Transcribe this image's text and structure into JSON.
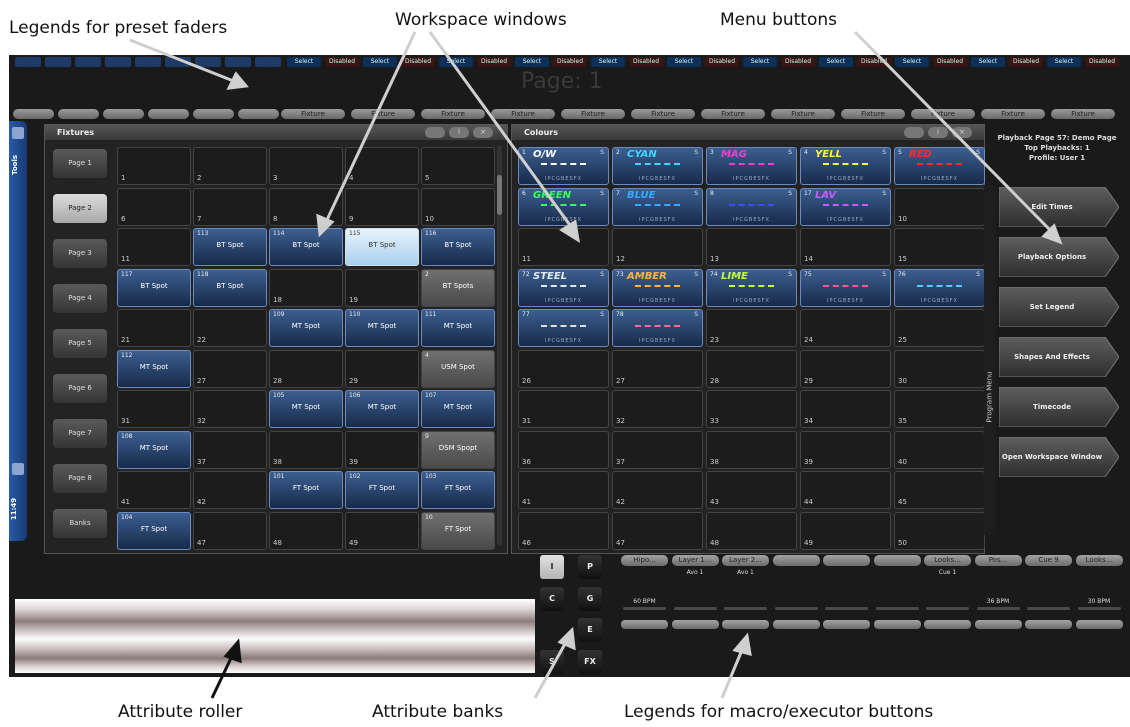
{
  "annotations": {
    "preset_faders": "Legends for preset faders",
    "workspace_windows": "Workspace windows",
    "menu_buttons": "Menu buttons",
    "attribute_roller": "Attribute roller",
    "attribute_banks": "Attribute banks",
    "macro_executor": "Legends for macro/executor buttons"
  },
  "top_strip": [
    {
      "label": "Select",
      "color": "#0d2f5a"
    },
    {
      "label": "Disabled",
      "color": "#3a1414"
    },
    {
      "label": "Select",
      "color": "#0d2f5a"
    },
    {
      "label": "Disabled",
      "color": "#3a1414"
    },
    {
      "label": "Select",
      "color": "#0d2f5a"
    },
    {
      "label": "Disabled",
      "color": "#3a1414"
    },
    {
      "label": "Select",
      "color": "#0d2f5a"
    },
    {
      "label": "Disabled",
      "color": "#3a1414"
    },
    {
      "label": "Select",
      "color": "#0d2f5a"
    },
    {
      "label": "Disabled",
      "color": "#3a1414"
    },
    {
      "label": "Select",
      "color": "#0d2f5a"
    },
    {
      "label": "Disabled",
      "color": "#3a1414"
    },
    {
      "label": "Select",
      "color": "#0d2f5a"
    },
    {
      "label": "Disabled",
      "color": "#3a1414"
    },
    {
      "label": "Select",
      "color": "#0d2f5a"
    },
    {
      "label": "Disabled",
      "color": "#3a1414"
    },
    {
      "label": "Select",
      "color": "#0d2f5a"
    },
    {
      "label": "Disabled",
      "color": "#3a1414"
    },
    {
      "label": "Select",
      "color": "#0d2f5a"
    },
    {
      "label": "Disabled",
      "color": "#3a1414"
    },
    {
      "label": "Select",
      "color": "#0d2f5a"
    },
    {
      "label": "Disabled",
      "color": "#3a1414"
    }
  ],
  "page_title": "Page: 1",
  "fixture_row": [
    "Fixture",
    "Fixture",
    "Fixture",
    "Fixture",
    "Fixture",
    "Fixture",
    "Fixture",
    "Fixture",
    "Fixture",
    "Fixture",
    "Fixture",
    "Fixture"
  ],
  "side_tab": {
    "tools": "Tools",
    "clock": "11:49"
  },
  "fixtures_window": {
    "title": "Fixtures",
    "pages": [
      "Page 1",
      "Page 2",
      "Page 3",
      "Page 4",
      "Page 5",
      "Page 6",
      "Page 7",
      "Page 8",
      "Banks"
    ],
    "selected_page": 1,
    "rows": [
      [
        {
          "n": "1"
        },
        {
          "n": "2"
        },
        {
          "n": "3"
        },
        {
          "n": "4"
        },
        {
          "n": "5"
        }
      ],
      [
        {
          "n": "6"
        },
        {
          "n": "7"
        },
        {
          "n": "8"
        },
        {
          "n": "9"
        },
        {
          "n": "10"
        }
      ],
      [
        {
          "n": "11"
        },
        {
          "n": "113",
          "label": "BT Spot",
          "style": "blue"
        },
        {
          "n": "114",
          "label": "BT Spot",
          "style": "blue"
        },
        {
          "n": "115",
          "label": "BT Spot",
          "style": "light"
        },
        {
          "n": "116",
          "label": "BT Spot",
          "style": "blue"
        }
      ],
      [
        {
          "n": "117",
          "label": "BT Spot",
          "style": "blue"
        },
        {
          "n": "118",
          "label": "BT Spot",
          "style": "blue"
        },
        {
          "n": "18"
        },
        {
          "n": "19"
        },
        {
          "n": "2",
          "label": "BT Spots",
          "style": "grey"
        }
      ],
      [
        {
          "n": "21"
        },
        {
          "n": "22"
        },
        {
          "n": "109",
          "label": "MT Spot",
          "style": "blue"
        },
        {
          "n": "110",
          "label": "MT Spot",
          "style": "blue"
        },
        {
          "n": "111",
          "label": "MT Spot",
          "style": "blue"
        }
      ],
      [
        {
          "n": "112",
          "label": "MT Spot",
          "style": "blue"
        },
        {
          "n": "27"
        },
        {
          "n": "28"
        },
        {
          "n": "29"
        },
        {
          "n": "4",
          "label": "USM Spot",
          "style": "grey"
        }
      ],
      [
        {
          "n": "31"
        },
        {
          "n": "32"
        },
        {
          "n": "105",
          "label": "MT Spot",
          "style": "blue"
        },
        {
          "n": "106",
          "label": "MT Spot",
          "style": "blue"
        },
        {
          "n": "107",
          "label": "MT Spot",
          "style": "blue"
        }
      ],
      [
        {
          "n": "108",
          "label": "MT Spot",
          "style": "blue"
        },
        {
          "n": "37"
        },
        {
          "n": "38"
        },
        {
          "n": "39"
        },
        {
          "n": "9",
          "label": "DSM Spopt",
          "style": "grey"
        }
      ],
      [
        {
          "n": "41"
        },
        {
          "n": "42"
        },
        {
          "n": "101",
          "label": "FT Spot",
          "style": "blue"
        },
        {
          "n": "102",
          "label": "FT Spot",
          "style": "blue"
        },
        {
          "n": "103",
          "label": "FT Spot",
          "style": "blue"
        }
      ],
      [
        {
          "n": "104",
          "label": "FT Spot",
          "style": "blue"
        },
        {
          "n": "47"
        },
        {
          "n": "48"
        },
        {
          "n": "49"
        },
        {
          "n": "10",
          "label": "FT Spot",
          "style": "grey"
        }
      ]
    ]
  },
  "colours_window": {
    "title": "Colours",
    "code": "IPCGBESFX",
    "rows": [
      [
        {
          "n": "1",
          "name": "O/W",
          "color": "#ffffff"
        },
        {
          "n": "2",
          "name": "CYAN",
          "color": "#3fd7ff"
        },
        {
          "n": "3",
          "name": "MAG",
          "color": "#ff3ad2"
        },
        {
          "n": "4",
          "name": "YELL",
          "color": "#fff23a"
        },
        {
          "n": "5",
          "name": "RED",
          "color": "#ff2a2a"
        }
      ],
      [
        {
          "n": "6",
          "name": "GREEN",
          "color": "#3aff5a"
        },
        {
          "n": "7",
          "name": "BLUE",
          "color": "#3aa8ff"
        },
        {
          "n": "8",
          "name": "",
          "color": "#3a4cff"
        },
        {
          "n": "17",
          "name": "LAV",
          "color": "#c65aff"
        },
        {
          "n": "10",
          "name": "",
          "color": ""
        }
      ],
      [
        {
          "n": "11",
          "name": "",
          "color": ""
        },
        {
          "n": "12",
          "name": "",
          "color": ""
        },
        {
          "n": "13",
          "name": "",
          "color": ""
        },
        {
          "n": "14",
          "name": "",
          "color": ""
        },
        {
          "n": "15",
          "name": "",
          "color": ""
        }
      ],
      [
        {
          "n": "72",
          "name": "STEEL",
          "color": "#e0e8f0"
        },
        {
          "n": "73",
          "name": "AMBER",
          "color": "#ffb43a"
        },
        {
          "n": "74",
          "name": "LIME",
          "color": "#c8ff3a"
        },
        {
          "n": "75",
          "name": "",
          "color": "#ff5a8c"
        },
        {
          "n": "76",
          "name": "",
          "color": "#5ac8ff"
        }
      ],
      [
        {
          "n": "77",
          "name": "",
          "color": "#e0e0e0"
        },
        {
          "n": "78",
          "name": "",
          "color": "#ff6a9a"
        },
        {
          "n": "23",
          "name": "",
          "color": ""
        },
        {
          "n": "24",
          "name": "",
          "color": ""
        },
        {
          "n": "25",
          "name": "",
          "color": ""
        }
      ],
      [
        {
          "n": "26",
          "name": "",
          "color": ""
        },
        {
          "n": "27",
          "name": "",
          "color": ""
        },
        {
          "n": "28",
          "name": "",
          "color": ""
        },
        {
          "n": "29",
          "name": "",
          "color": ""
        },
        {
          "n": "30",
          "name": "",
          "color": ""
        }
      ],
      [
        {
          "n": "31",
          "name": "",
          "color": ""
        },
        {
          "n": "32",
          "name": "",
          "color": ""
        },
        {
          "n": "33",
          "name": "",
          "color": ""
        },
        {
          "n": "34",
          "name": "",
          "color": ""
        },
        {
          "n": "35",
          "name": "",
          "color": ""
        }
      ],
      [
        {
          "n": "36",
          "name": "",
          "color": ""
        },
        {
          "n": "37",
          "name": "",
          "color": ""
        },
        {
          "n": "38",
          "name": "",
          "color": ""
        },
        {
          "n": "39",
          "name": "",
          "color": ""
        },
        {
          "n": "40",
          "name": "",
          "color": ""
        }
      ],
      [
        {
          "n": "41",
          "name": "",
          "color": ""
        },
        {
          "n": "42",
          "name": "",
          "color": ""
        },
        {
          "n": "43",
          "name": "",
          "color": ""
        },
        {
          "n": "44",
          "name": "",
          "color": ""
        },
        {
          "n": "45",
          "name": "",
          "color": ""
        }
      ],
      [
        {
          "n": "46",
          "name": "",
          "color": ""
        },
        {
          "n": "47",
          "name": "",
          "color": ""
        },
        {
          "n": "48",
          "name": "",
          "color": ""
        },
        {
          "n": "49",
          "name": "",
          "color": ""
        },
        {
          "n": "50",
          "name": "",
          "color": ""
        }
      ]
    ]
  },
  "playback_info": {
    "line1": "Playback Page 57: Demo Page",
    "line2": "Top Playbacks: 1",
    "line3": "Profile: User 1"
  },
  "program_menu_label": "Program Menu",
  "menu_buttons": [
    "Edit Times",
    "Playback Options",
    "Set Legend",
    "Shapes And Effects",
    "Timecode",
    "Open Workspace Window"
  ],
  "attribute_banks": [
    "I",
    "P",
    "C",
    "G",
    "E",
    "S",
    "FX"
  ],
  "executors": [
    {
      "label": "Hipo...",
      "sub": "",
      "bpm": "60 BPM"
    },
    {
      "label": "Layer 1...",
      "sub": "Avo 1",
      "bpm": ""
    },
    {
      "label": "Layer 2...",
      "sub": "Avo 1",
      "bpm": ""
    },
    {
      "label": "",
      "sub": "",
      "bpm": ""
    },
    {
      "label": "",
      "sub": "",
      "bpm": ""
    },
    {
      "label": "",
      "sub": "",
      "bpm": ""
    },
    {
      "label": "Looks...",
      "sub": "Cue 1",
      "bpm": ""
    },
    {
      "label": "Pos...",
      "sub": "",
      "bpm": "36 BPM"
    },
    {
      "label": "Cue 9",
      "sub": "",
      "bpm": ""
    },
    {
      "label": "Looks...",
      "sub": "",
      "bpm": "30 BPM"
    }
  ]
}
